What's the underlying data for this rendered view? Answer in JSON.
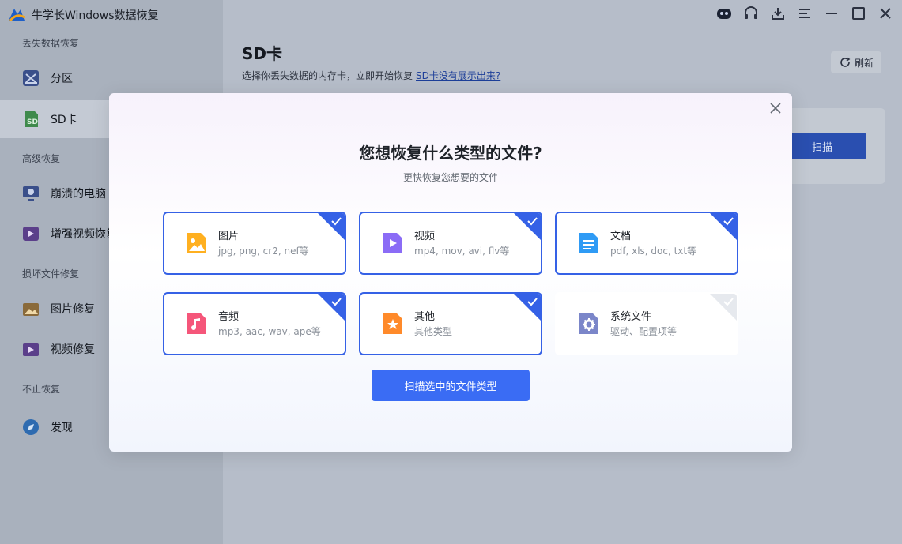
{
  "app": {
    "title": "牛学长Windows数据恢复"
  },
  "sidebar": {
    "sections": [
      {
        "label": "丢失数据恢复"
      },
      {
        "label": "高级恢复"
      },
      {
        "label": "损坏文件修复"
      },
      {
        "label": "不止恢复"
      }
    ],
    "items": [
      {
        "label": "分区",
        "icon": "partition-icon"
      },
      {
        "label": "SD卡",
        "icon": "sd-card-icon"
      },
      {
        "label": "崩溃的电脑",
        "icon": "crashed-pc-icon"
      },
      {
        "label": "增强视频恢复",
        "icon": "enhanced-video-icon"
      },
      {
        "label": "图片修复",
        "icon": "photo-repair-icon"
      },
      {
        "label": "视频修复",
        "icon": "video-repair-icon"
      },
      {
        "label": "发现",
        "icon": "compass-icon"
      }
    ]
  },
  "main": {
    "title": "SD卡",
    "subtitle": "选择你丢失数据的内存卡，立即开始恢复",
    "subtitle_link": "SD卡没有展示出来?",
    "refresh_label": "刷新",
    "scan_label": "扫描"
  },
  "modal": {
    "title": "您想恢复什么类型的文件?",
    "subtitle": "更快恢复您想要的文件",
    "file_types": [
      {
        "name": "图片",
        "desc": "jpg, png, cr2, nef等",
        "icon": "image-file-icon",
        "color": "#ffb020",
        "checked": true
      },
      {
        "name": "视频",
        "desc": "mp4, mov, avi, flv等",
        "icon": "video-file-icon",
        "color": "#8b6cf6",
        "checked": true
      },
      {
        "name": "文档",
        "desc": "pdf, xls, doc, txt等",
        "icon": "document-file-icon",
        "color": "#2f9bf5",
        "checked": true
      },
      {
        "name": "音频",
        "desc": "mp3, aac, wav, ape等",
        "icon": "audio-file-icon",
        "color": "#f5567a",
        "checked": true
      },
      {
        "name": "其他",
        "desc": "其他类型",
        "icon": "other-file-icon",
        "color": "#ff8a2a",
        "checked": true
      },
      {
        "name": "系统文件",
        "desc": "驱动、配置项等",
        "icon": "system-file-icon",
        "color": "#7b86c9",
        "checked": false
      }
    ],
    "scan_selected_label": "扫描选中的文件类型"
  }
}
